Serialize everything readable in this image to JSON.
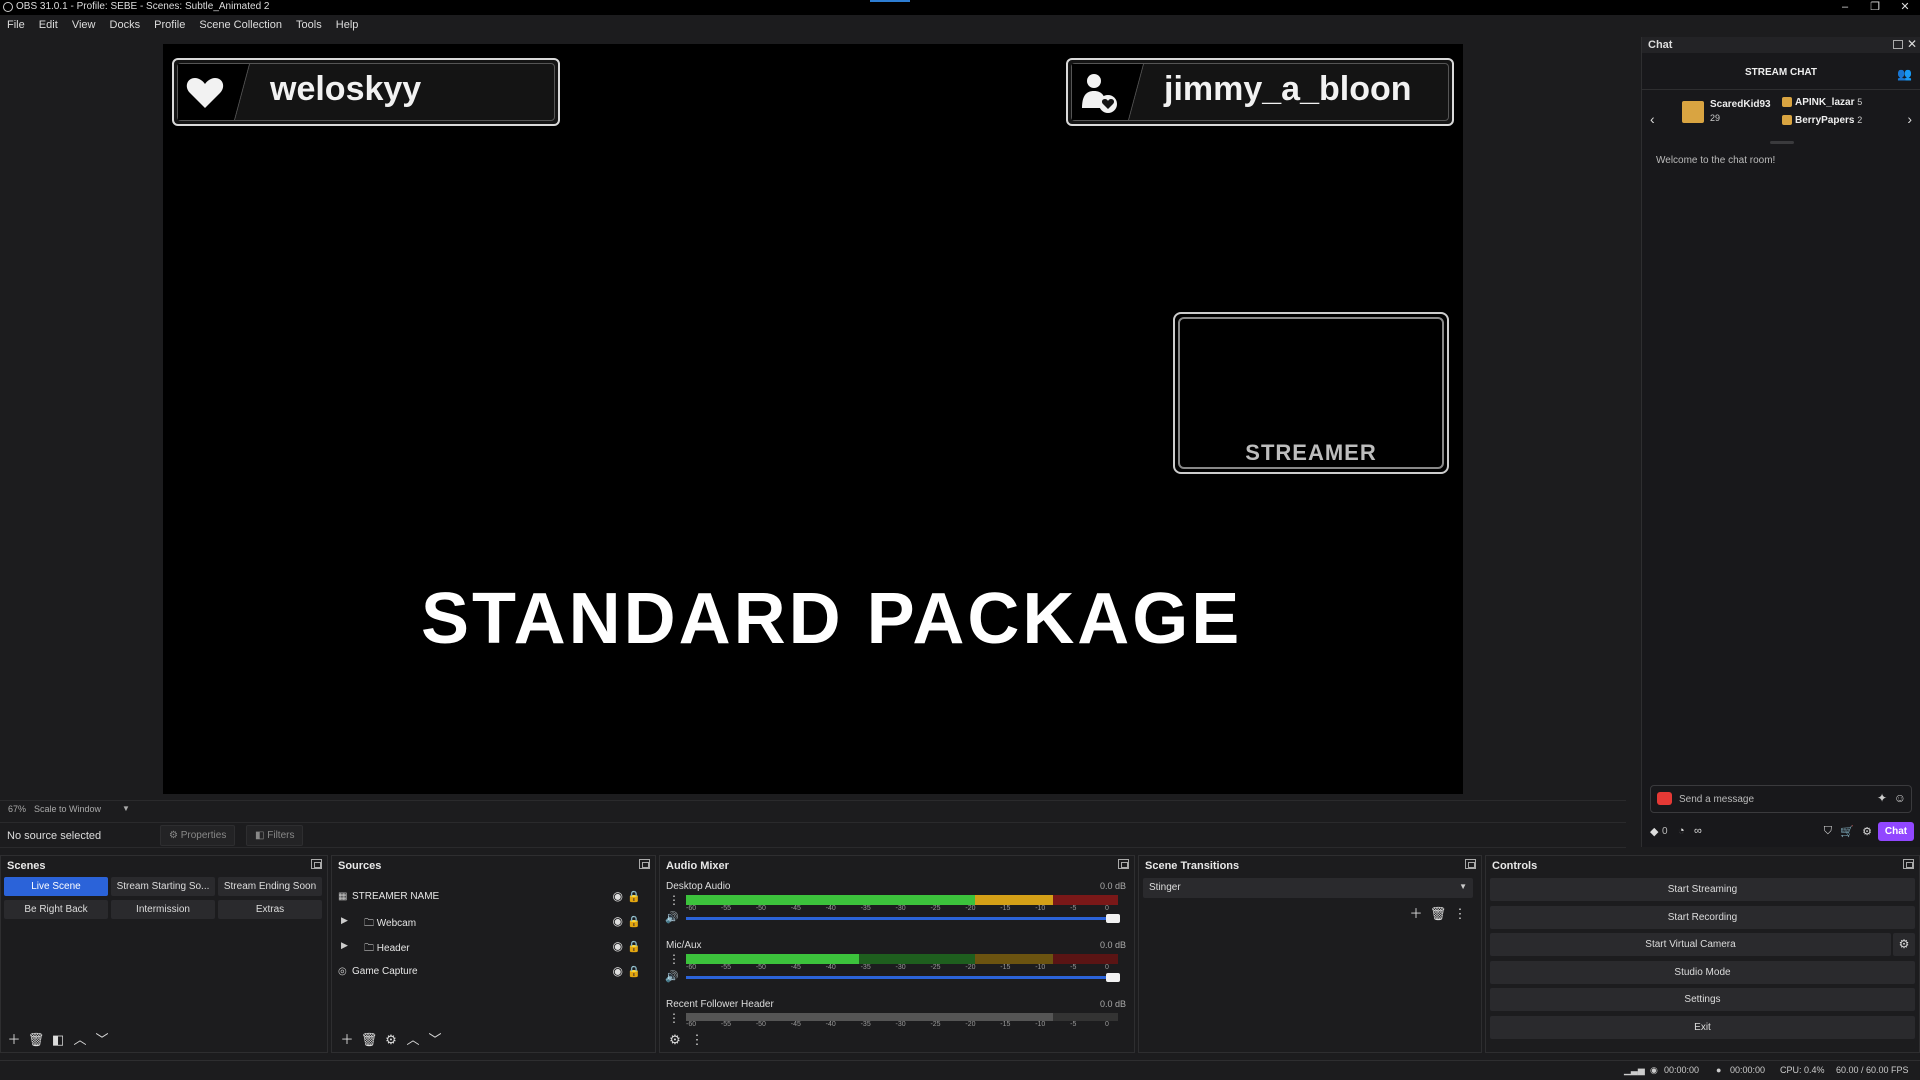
{
  "window": {
    "title": "OBS 31.0.1 - Profile: SEBE - Scenes: Subtle_Animated 2",
    "minimize": "–",
    "maximize": "❐",
    "close": "✕"
  },
  "menu": [
    "File",
    "Edit",
    "View",
    "Docks",
    "Profile",
    "Scene Collection",
    "Tools",
    "Help"
  ],
  "canvas": {
    "left_name": "weloskyy",
    "right_name": "jimmy_a_bloon",
    "camera_label": "STREAMER",
    "headline": "STANDARD PACKAGE"
  },
  "zoom": {
    "level": "67%",
    "mode": "Scale to Window"
  },
  "properties_bar": {
    "status": "No source selected",
    "properties": "Properties",
    "filters": "Filters"
  },
  "scenes": {
    "title": "Scenes",
    "items": [
      {
        "label": "Live Scene",
        "active": true
      },
      {
        "label": "Stream Starting So...",
        "active": false
      },
      {
        "label": "Stream Ending Soon",
        "active": false
      },
      {
        "label": "Be Right Back",
        "active": false
      },
      {
        "label": "Intermission",
        "active": false
      },
      {
        "label": "Extras",
        "active": false
      }
    ]
  },
  "sources": {
    "title": "Sources",
    "items": [
      {
        "label": "STREAMER NAME",
        "type": "group"
      },
      {
        "label": "Webcam",
        "type": "folder"
      },
      {
        "label": "Header",
        "type": "folder"
      },
      {
        "label": "Game Capture",
        "type": "capture"
      }
    ]
  },
  "audio_mixer": {
    "title": "Audio Mixer",
    "channels": [
      {
        "name": "Desktop Audio",
        "db": "0.0 dB"
      },
      {
        "name": "Mic/Aux",
        "db": "0.0 dB"
      },
      {
        "name": "Recent Follower Header",
        "db": "0.0 dB"
      }
    ],
    "ticks": [
      "-60",
      "-55",
      "-50",
      "-45",
      "-40",
      "-35",
      "-30",
      "-25",
      "-20",
      "-15",
      "-10",
      "-5",
      "0"
    ]
  },
  "scene_transitions": {
    "title": "Scene Transitions",
    "selected": "Stinger"
  },
  "controls": {
    "title": "Controls",
    "buttons": [
      "Start Streaming",
      "Start Recording",
      "Start Virtual Camera",
      "Studio Mode",
      "Settings",
      "Exit"
    ]
  },
  "chat": {
    "dock_title": "Chat",
    "header": "STREAM CHAT",
    "gifters": [
      {
        "name": "ScaredKid93",
        "count": "29"
      },
      {
        "name": "APINK_lazar",
        "count": "5"
      },
      {
        "name": "BerryPapers",
        "count": "2"
      }
    ],
    "welcome": "Welcome to the chat room!",
    "placeholder": "Send a message",
    "points": "0",
    "infinity": "∞",
    "chat_button": "Chat"
  },
  "status": {
    "stream_time": "00:00:00",
    "rec_time": "00:00:00",
    "cpu": "CPU: 0.4%",
    "fps": "60.00 / 60.00 FPS"
  },
  "colors": {
    "accent": "#2b63d9",
    "meter_green": "#3cc23c",
    "meter_yellow": "#d4a017",
    "meter_red": "#b22222",
    "chat_purple": "#9147ff"
  }
}
